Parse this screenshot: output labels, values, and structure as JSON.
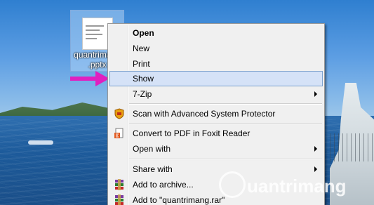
{
  "desktop": {
    "file": {
      "label_line1": "quantrimang",
      "label_line2": ".pptx",
      "icon": "powerpoint-file-icon"
    },
    "arrow_color": "#e020c0"
  },
  "context_menu": {
    "items": [
      {
        "label": "Open",
        "bold": true,
        "icon": null,
        "submenu": false
      },
      {
        "label": "New",
        "bold": false,
        "icon": null,
        "submenu": false
      },
      {
        "label": "Print",
        "bold": false,
        "icon": null,
        "submenu": false
      },
      {
        "label": "Show",
        "bold": false,
        "icon": null,
        "submenu": false,
        "highlighted": true
      },
      {
        "label": "7-Zip",
        "bold": false,
        "icon": null,
        "submenu": true
      },
      {
        "label": "Scan with Advanced System Protector",
        "bold": false,
        "icon": "shield-icon",
        "submenu": false
      },
      {
        "label": "Convert to PDF in Foxit Reader",
        "bold": false,
        "icon": "foxit-pdf-icon",
        "submenu": false
      },
      {
        "label": "Open with",
        "bold": false,
        "icon": null,
        "submenu": true
      },
      {
        "label": "Share with",
        "bold": false,
        "icon": null,
        "submenu": true
      },
      {
        "label": "Add to archive...",
        "bold": false,
        "icon": "winrar-icon",
        "submenu": false
      },
      {
        "label": "Add to \"quantrimang.rar\"",
        "bold": false,
        "icon": "winrar-icon",
        "submenu": false
      }
    ],
    "highlight_color": "#d5e2f7"
  },
  "watermark": {
    "text": "uantrimang"
  }
}
